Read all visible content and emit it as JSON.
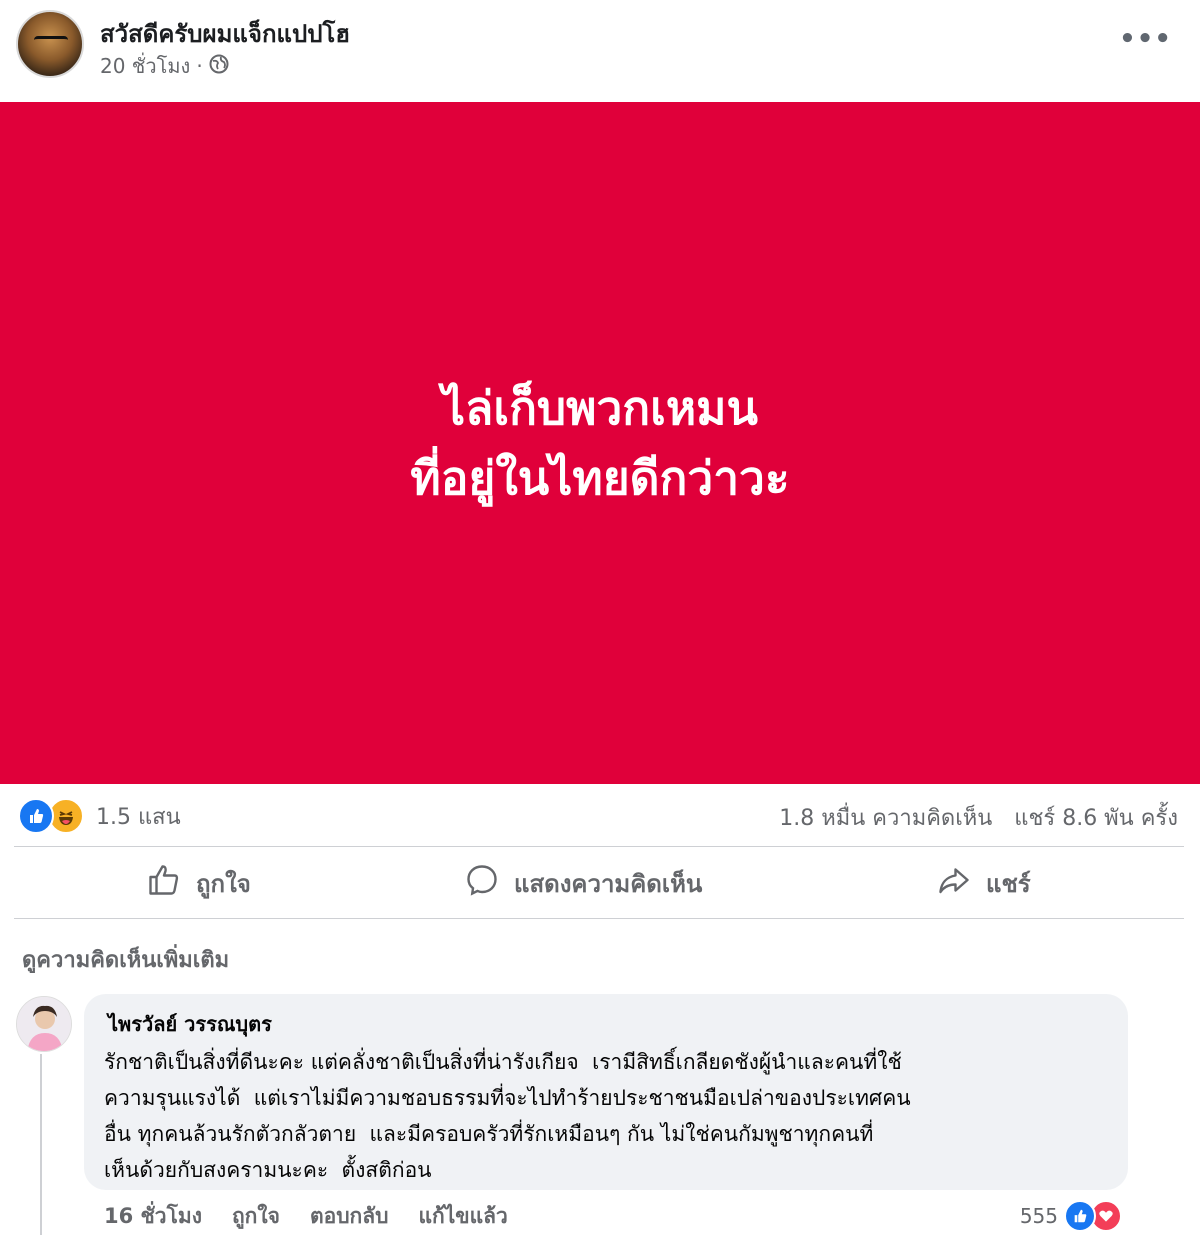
{
  "post": {
    "author": "สวัสดีครับผมแจ็กแปปโฮ",
    "time": "20 ชั่วโมง",
    "separator": "·",
    "privacy_icon": "globe-icon",
    "more_icon": "more-horizontal-icon",
    "more_text": "•••",
    "banner_color": "#e0003a",
    "banner_lines": [
      "ไล่เก็บพวกเหมน",
      "ที่อยู่ในไทยดีกว่าวะ"
    ]
  },
  "stats": {
    "reactions": [
      "like",
      "haha"
    ],
    "reaction_count": "1.5 แสน",
    "comments": "1.8 หมื่น ความคิดเห็น",
    "shares": "แชร์ 8.6 พัน ครั้ง"
  },
  "actions": {
    "like": "ถูกใจ",
    "comment": "แสดงความคิดเห็น",
    "share": "แชร์"
  },
  "comments_section": {
    "view_more": "ดูความคิดเห็นเพิ่มเติม",
    "comment": {
      "author": "ไพรวัลย์ วรรณบุตร",
      "lines": [
        "รักชาติเป็นสิ่งที่ดีนะคะ แต่คลั่งชาติเป็นสิ่งที่น่ารังเกียจ ￼ เรามีสิทธิ์เกลียดชังผู้นำและคนที่ใช้",
        "ความรุนแรงได้ ￼ แต่เราไม่มีความชอบธรรมที่จะไปทำร้ายประชาชนมือเปล่าของประเทศคน",
        "อื่น ￼ทุกคนล้วนรักตัวกลัวตาย ￼ และมีครอบครัวที่รักเหมือนๆ กัน ไม่ใช่คนกัมพูชาทุกคนที่",
        "เห็นด้วยกับสงครามนะคะ ￼ ตั้งสติก่อน"
      ],
      "time": "16 ชั่วโมง",
      "like": "ถูกใจ",
      "reply": "ตอบกลับ",
      "edited": "แก้ไขแล้ว",
      "reaction_count": "555",
      "reactions": [
        "like",
        "love"
      ]
    }
  }
}
